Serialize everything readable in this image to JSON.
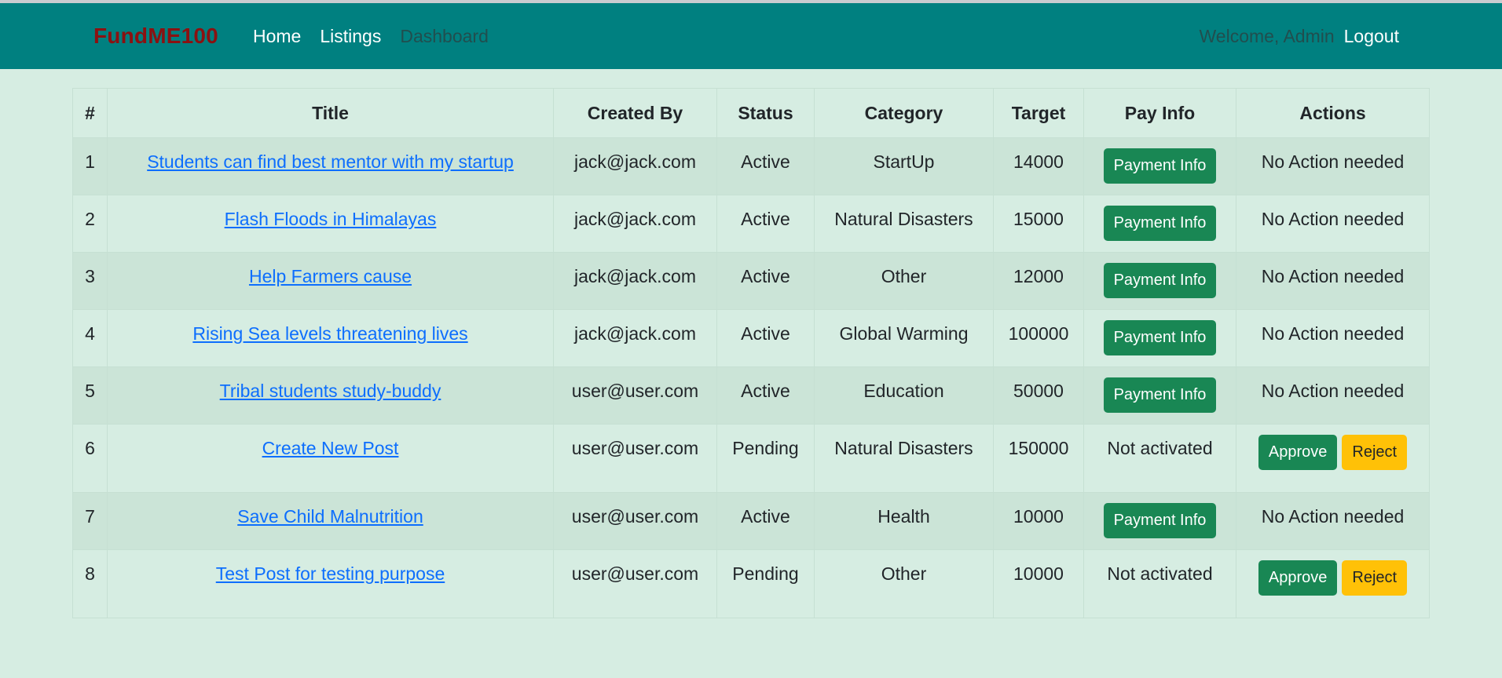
{
  "navbar": {
    "brand": "FundME100",
    "links": [
      "Home",
      "Listings",
      "Dashboard"
    ],
    "welcome": "Welcome, Admin",
    "logout": "Logout"
  },
  "table": {
    "headers": [
      "#",
      "Title",
      "Created By",
      "Status",
      "Category",
      "Target",
      "Pay Info",
      "Actions"
    ],
    "rows": [
      {
        "num": "1",
        "title": "Students can find best mentor with my startup",
        "created_by": "jack@jack.com",
        "status": "Active",
        "category": "StartUp",
        "target": "14000",
        "pay_info": "Payment Info",
        "pay_is_button": true,
        "actions": "No Action needed",
        "actions_are_buttons": false
      },
      {
        "num": "2",
        "title": "Flash Floods in Himalayas",
        "created_by": "jack@jack.com",
        "status": "Active",
        "category": "Natural Disasters",
        "target": "15000",
        "pay_info": "Payment Info",
        "pay_is_button": true,
        "actions": "No Action needed",
        "actions_are_buttons": false
      },
      {
        "num": "3",
        "title": "Help Farmers cause",
        "created_by": "jack@jack.com",
        "status": "Active",
        "category": "Other",
        "target": "12000",
        "pay_info": "Payment Info",
        "pay_is_button": true,
        "actions": "No Action needed",
        "actions_are_buttons": false
      },
      {
        "num": "4",
        "title": "Rising Sea levels threatening lives",
        "created_by": "jack@jack.com",
        "status": "Active",
        "category": "Global Warming",
        "target": "100000",
        "pay_info": "Payment Info",
        "pay_is_button": true,
        "actions": "No Action needed",
        "actions_are_buttons": false
      },
      {
        "num": "5",
        "title": "Tribal students study-buddy",
        "created_by": "user@user.com",
        "status": "Active",
        "category": "Education",
        "target": "50000",
        "pay_info": "Payment Info",
        "pay_is_button": true,
        "actions": "No Action needed",
        "actions_are_buttons": false
      },
      {
        "num": "6",
        "title": "Create New Post",
        "created_by": "user@user.com",
        "status": "Pending",
        "category": "Natural Disasters",
        "target": "150000",
        "pay_info": "Not activated",
        "pay_is_button": false,
        "approve": "Approve",
        "reject": "Reject",
        "actions_are_buttons": true
      },
      {
        "num": "7",
        "title": "Save Child Malnutrition",
        "created_by": "user@user.com",
        "status": "Active",
        "category": "Health",
        "target": "10000",
        "pay_info": "Payment Info",
        "pay_is_button": true,
        "actions": "No Action needed",
        "actions_are_buttons": false
      },
      {
        "num": "8",
        "title": "Test Post for testing purpose",
        "created_by": "user@user.com",
        "status": "Pending",
        "category": "Other",
        "target": "10000",
        "pay_info": "Not activated",
        "pay_is_button": false,
        "approve": "Approve",
        "reject": "Reject",
        "actions_are_buttons": true
      }
    ]
  },
  "colors": {
    "navbar_bg": "#008080",
    "brand": "#8b1111",
    "page_bg": "#d6ede2",
    "striped_row": "#cbe4d7",
    "link": "#0d6efd",
    "success_button": "#198754",
    "warning_button": "#ffc107"
  }
}
